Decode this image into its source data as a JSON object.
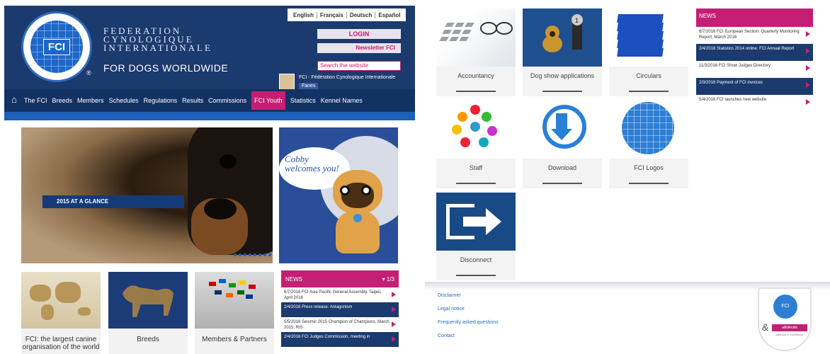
{
  "brand": {
    "logo_text": "FCI",
    "name_lines": [
      "FEDERATION",
      "CYNOLOGIQUE",
      "INTERNATIONALE"
    ],
    "tagline": "FOR DOGS WORLDWIDE",
    "registered_mark": "®"
  },
  "languages": [
    "English",
    "Français",
    "Deutsch",
    "Español"
  ],
  "header_actions": {
    "login": "LOGIN",
    "newsletter": "Newsletter FCI",
    "search_placeholder": "Search the website"
  },
  "facebook": {
    "page_name": "FCI - Fédération Cynologique Internationale",
    "button": "Fanes"
  },
  "nav": {
    "items": [
      "The FCI",
      "Breeds",
      "Members",
      "Schedules",
      "Regulations",
      "Results",
      "Commissions",
      "FCI Youth",
      "Statistics",
      "Kennel Names"
    ],
    "active": "FCI Youth"
  },
  "hero": {
    "label": "2015 AT A GLANCE"
  },
  "cobby": {
    "text": "Cobby welcomes you!"
  },
  "tiles": [
    {
      "label": "FCI: the largest canine organisation of the world"
    },
    {
      "label": "Breeds"
    },
    {
      "label": "Members & Partners"
    }
  ],
  "news_left": {
    "header": "NEWS",
    "page": "1/3",
    "items": [
      {
        "date": "6/7/2016",
        "text": "FCI Asia Pacific General Assembly, Taipei, April 2016"
      },
      {
        "date": "2/4/2016",
        "text": "Press release: Antagonism"
      },
      {
        "date": "5/5/2016",
        "text": "Seismic 2015 Champion of Champions, March 2015, RIS"
      },
      {
        "date": "2/4/2016",
        "text": "FCI Judges Commission, meeting in"
      }
    ]
  },
  "apps": [
    {
      "label": "Accountancy",
      "icon": "calculator-icon"
    },
    {
      "label": "Dog show applications",
      "icon": "dog-trophy-icon"
    },
    {
      "label": "Circulars",
      "icon": "folders-icon"
    },
    {
      "label": "Staff",
      "icon": "people-network-icon"
    },
    {
      "label": "Download",
      "icon": "download-icon"
    },
    {
      "label": "FCI Logos",
      "icon": "fci-globe-icon"
    },
    {
      "label": "Disconnect",
      "icon": "logout-icon"
    }
  ],
  "news_right": {
    "header": "NEWS",
    "items": [
      {
        "date": "6/7/2016",
        "text": "FCI European Section: Quarterly Monitoring Report, March 2016"
      },
      {
        "date": "2/4/2016",
        "text": "Statistics 2014 online: FCI Annual Report"
      },
      {
        "date": "11/3/2016",
        "text": "FCI Show Judges Directory"
      },
      {
        "date": "2/3/2016",
        "text": "Payment of FCI invoices"
      },
      {
        "date": "5/4/2016",
        "text": "FCI launches new website"
      }
    ]
  },
  "footer_links": [
    "Disclaimer",
    "Legal notice",
    "Frequently asked questions",
    "Contact"
  ],
  "badge": {
    "logo": "FCI",
    "amp": "&",
    "pill": "aillofinoifs",
    "sub": "partners in excellence"
  },
  "colors": {
    "navy": "#1b3a6e",
    "magenta": "#c41f74",
    "blue": "#1e5fb8"
  }
}
